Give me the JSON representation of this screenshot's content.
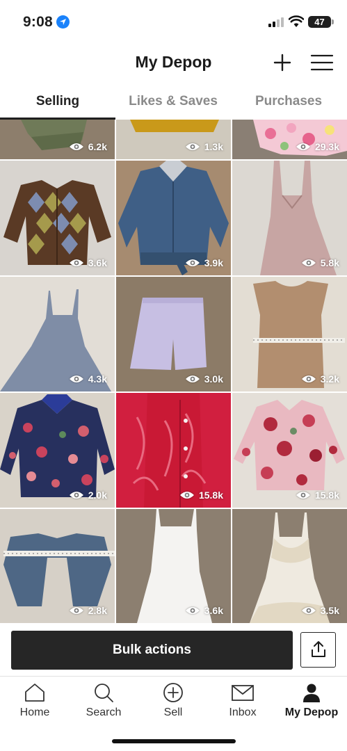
{
  "status_bar": {
    "time": "9:08",
    "battery": "47"
  },
  "header": {
    "title": "My Depop"
  },
  "tabs": [
    {
      "label": "Selling",
      "active": true
    },
    {
      "label": "Likes & Saves",
      "active": false
    },
    {
      "label": "Purchases",
      "active": false
    }
  ],
  "listings": [
    {
      "views": "6.2k",
      "item": "olive pants"
    },
    {
      "views": "1.3k",
      "item": "mustard top"
    },
    {
      "views": "29.3k",
      "item": "floral skirt"
    },
    {
      "views": "3.6k",
      "item": "argyle cardigan"
    },
    {
      "views": "3.9k",
      "item": "denim jacket"
    },
    {
      "views": "5.8k",
      "item": "mauve dress"
    },
    {
      "views": "4.3k",
      "item": "blue slip dress"
    },
    {
      "views": "3.0k",
      "item": "lavender shorts"
    },
    {
      "views": "3.2k",
      "item": "tan knit tank"
    },
    {
      "views": "2.0k",
      "item": "floral blazer"
    },
    {
      "views": "15.8k",
      "item": "red lace shirt"
    },
    {
      "views": "15.8k",
      "item": "pink floral blouse"
    },
    {
      "views": "2.8k",
      "item": "denim shrug"
    },
    {
      "views": "3.6k",
      "item": "white slip dress"
    },
    {
      "views": "3.5k",
      "item": "lace slip dress"
    }
  ],
  "bulk": {
    "label": "Bulk actions"
  },
  "nav": [
    {
      "label": "Home",
      "icon": "home-icon",
      "active": false
    },
    {
      "label": "Search",
      "icon": "search-icon",
      "active": false
    },
    {
      "label": "Sell",
      "icon": "sell-plus-icon",
      "active": false
    },
    {
      "label": "Inbox",
      "icon": "inbox-icon",
      "active": false
    },
    {
      "label": "My Depop",
      "icon": "profile-icon",
      "active": true
    }
  ],
  "colors": {
    "accent": "#262626",
    "location": "#1a82fb",
    "inactive_tab": "#8a8a8a"
  }
}
